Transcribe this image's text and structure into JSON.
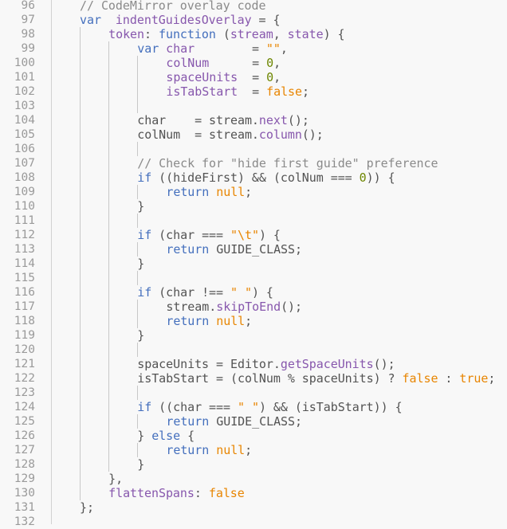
{
  "editor": {
    "language": "javascript",
    "lines": [
      {
        "n": "96",
        "indent": 0,
        "guides": [],
        "tokens": [
          [
            "cm",
            "// CodeMirror overlay code"
          ]
        ]
      },
      {
        "n": "97",
        "indent": 0,
        "guides": [],
        "tokens": [
          [
            "kw",
            "var"
          ],
          [
            "",
            "  "
          ],
          [
            "def",
            "indentGuidesOverlay"
          ],
          [
            "",
            " = {"
          ]
        ]
      },
      {
        "n": "98",
        "indent": 1,
        "guides": [
          0
        ],
        "tokens": [
          [
            "prop",
            "token"
          ],
          [
            "",
            ": "
          ],
          [
            "kw",
            "function"
          ],
          [
            "",
            " ("
          ],
          [
            "def",
            "stream"
          ],
          [
            "",
            ", "
          ],
          [
            "def",
            "state"
          ],
          [
            "",
            ") {"
          ]
        ]
      },
      {
        "n": "99",
        "indent": 2,
        "guides": [
          0,
          1
        ],
        "tokens": [
          [
            "kw",
            "var"
          ],
          [
            "",
            " "
          ],
          [
            "def",
            "char"
          ],
          [
            "",
            "        = "
          ],
          [
            "str",
            "\"\""
          ],
          [
            "",
            ","
          ]
        ]
      },
      {
        "n": "100",
        "indent": 3,
        "guides": [
          0,
          1,
          2
        ],
        "tokens": [
          [
            "def",
            "colNum"
          ],
          [
            "",
            "      = "
          ],
          [
            "num",
            "0"
          ],
          [
            "",
            ","
          ]
        ]
      },
      {
        "n": "101",
        "indent": 3,
        "guides": [
          0,
          1,
          2
        ],
        "tokens": [
          [
            "def",
            "spaceUnits"
          ],
          [
            "",
            "  = "
          ],
          [
            "num",
            "0"
          ],
          [
            "",
            ","
          ]
        ]
      },
      {
        "n": "102",
        "indent": 3,
        "guides": [
          0,
          1,
          2
        ],
        "tokens": [
          [
            "def",
            "isTabStart"
          ],
          [
            "",
            "  = "
          ],
          [
            "atom",
            "false"
          ],
          [
            "",
            ";"
          ]
        ]
      },
      {
        "n": "103",
        "indent": 0,
        "guides": [
          0,
          1,
          2
        ],
        "tokens": []
      },
      {
        "n": "104",
        "indent": 2,
        "guides": [
          0,
          1
        ],
        "tokens": [
          [
            "",
            "char    = stream."
          ],
          [
            "fn",
            "next"
          ],
          [
            "",
            "();"
          ]
        ]
      },
      {
        "n": "105",
        "indent": 2,
        "guides": [
          0,
          1
        ],
        "tokens": [
          [
            "",
            "colNum  = stream."
          ],
          [
            "fn",
            "column"
          ],
          [
            "",
            "();"
          ]
        ]
      },
      {
        "n": "106",
        "indent": 0,
        "guides": [
          0,
          1,
          2
        ],
        "tokens": []
      },
      {
        "n": "107",
        "indent": 2,
        "guides": [
          0,
          1
        ],
        "tokens": [
          [
            "cm",
            "// Check for \"hide first guide\" preference"
          ]
        ]
      },
      {
        "n": "108",
        "indent": 2,
        "guides": [
          0,
          1
        ],
        "tokens": [
          [
            "kw",
            "if"
          ],
          [
            "",
            " ((hideFirst) && (colNum === "
          ],
          [
            "num",
            "0"
          ],
          [
            "",
            ")) {"
          ]
        ]
      },
      {
        "n": "109",
        "indent": 3,
        "guides": [
          0,
          1,
          2
        ],
        "tokens": [
          [
            "kw",
            "return"
          ],
          [
            "",
            " "
          ],
          [
            "atom",
            "null"
          ],
          [
            "",
            ";"
          ]
        ]
      },
      {
        "n": "110",
        "indent": 2,
        "guides": [
          0,
          1
        ],
        "tokens": [
          [
            "",
            "}"
          ]
        ]
      },
      {
        "n": "111",
        "indent": 0,
        "guides": [
          0,
          1,
          2
        ],
        "tokens": []
      },
      {
        "n": "112",
        "indent": 2,
        "guides": [
          0,
          1
        ],
        "tokens": [
          [
            "kw",
            "if"
          ],
          [
            "",
            " (char === "
          ],
          [
            "str",
            "\"\\t\""
          ],
          [
            "",
            ") {"
          ]
        ]
      },
      {
        "n": "113",
        "indent": 3,
        "guides": [
          0,
          1,
          2
        ],
        "tokens": [
          [
            "kw",
            "return"
          ],
          [
            "",
            " GUIDE_CLASS;"
          ]
        ]
      },
      {
        "n": "114",
        "indent": 2,
        "guides": [
          0,
          1
        ],
        "tokens": [
          [
            "",
            "}"
          ]
        ]
      },
      {
        "n": "115",
        "indent": 0,
        "guides": [
          0,
          1,
          2
        ],
        "tokens": []
      },
      {
        "n": "116",
        "indent": 2,
        "guides": [
          0,
          1
        ],
        "tokens": [
          [
            "kw",
            "if"
          ],
          [
            "",
            " (char !== "
          ],
          [
            "str",
            "\" \""
          ],
          [
            "",
            ") {"
          ]
        ]
      },
      {
        "n": "117",
        "indent": 3,
        "guides": [
          0,
          1,
          2
        ],
        "tokens": [
          [
            "",
            "stream."
          ],
          [
            "fn",
            "skipToEnd"
          ],
          [
            "",
            "();"
          ]
        ]
      },
      {
        "n": "118",
        "indent": 3,
        "guides": [
          0,
          1,
          2
        ],
        "tokens": [
          [
            "kw",
            "return"
          ],
          [
            "",
            " "
          ],
          [
            "atom",
            "null"
          ],
          [
            "",
            ";"
          ]
        ]
      },
      {
        "n": "119",
        "indent": 2,
        "guides": [
          0,
          1
        ],
        "tokens": [
          [
            "",
            "}"
          ]
        ]
      },
      {
        "n": "120",
        "indent": 0,
        "guides": [
          0,
          1,
          2
        ],
        "tokens": []
      },
      {
        "n": "121",
        "indent": 2,
        "guides": [
          0,
          1
        ],
        "tokens": [
          [
            "",
            "spaceUnits = Editor."
          ],
          [
            "fn",
            "getSpaceUnits"
          ],
          [
            "",
            "();"
          ]
        ]
      },
      {
        "n": "122",
        "indent": 2,
        "guides": [
          0,
          1
        ],
        "tokens": [
          [
            "",
            "isTabStart = (colNum % spaceUnits) ? "
          ],
          [
            "atom",
            "false"
          ],
          [
            "",
            " : "
          ],
          [
            "atom",
            "true"
          ],
          [
            "",
            ";"
          ]
        ]
      },
      {
        "n": "123",
        "indent": 0,
        "guides": [
          0,
          1,
          2
        ],
        "tokens": []
      },
      {
        "n": "124",
        "indent": 2,
        "guides": [
          0,
          1
        ],
        "tokens": [
          [
            "kw",
            "if"
          ],
          [
            "",
            " ((char === "
          ],
          [
            "str",
            "\" \""
          ],
          [
            "",
            ") && (isTabStart)) {"
          ]
        ]
      },
      {
        "n": "125",
        "indent": 3,
        "guides": [
          0,
          1,
          2
        ],
        "tokens": [
          [
            "kw",
            "return"
          ],
          [
            "",
            " GUIDE_CLASS;"
          ]
        ]
      },
      {
        "n": "126",
        "indent": 2,
        "guides": [
          0,
          1
        ],
        "tokens": [
          [
            "",
            "} "
          ],
          [
            "kw",
            "else"
          ],
          [
            "",
            " {"
          ]
        ]
      },
      {
        "n": "127",
        "indent": 3,
        "guides": [
          0,
          1,
          2
        ],
        "tokens": [
          [
            "kw",
            "return"
          ],
          [
            "",
            " "
          ],
          [
            "atom",
            "null"
          ],
          [
            "",
            ";"
          ]
        ]
      },
      {
        "n": "128",
        "indent": 2,
        "guides": [
          0,
          1
        ],
        "tokens": [
          [
            "",
            "}"
          ]
        ]
      },
      {
        "n": "129",
        "indent": 1,
        "guides": [
          0
        ],
        "tokens": [
          [
            "",
            "},"
          ]
        ]
      },
      {
        "n": "130",
        "indent": 1,
        "guides": [
          0
        ],
        "tokens": [
          [
            "prop",
            "flattenSpans"
          ],
          [
            "",
            ": "
          ],
          [
            "atom",
            "false"
          ]
        ]
      },
      {
        "n": "131",
        "indent": 0,
        "guides": [],
        "tokens": [
          [
            "",
            "};"
          ]
        ]
      },
      {
        "n": "132",
        "indent": 0,
        "guides": [],
        "tokens": []
      }
    ]
  }
}
